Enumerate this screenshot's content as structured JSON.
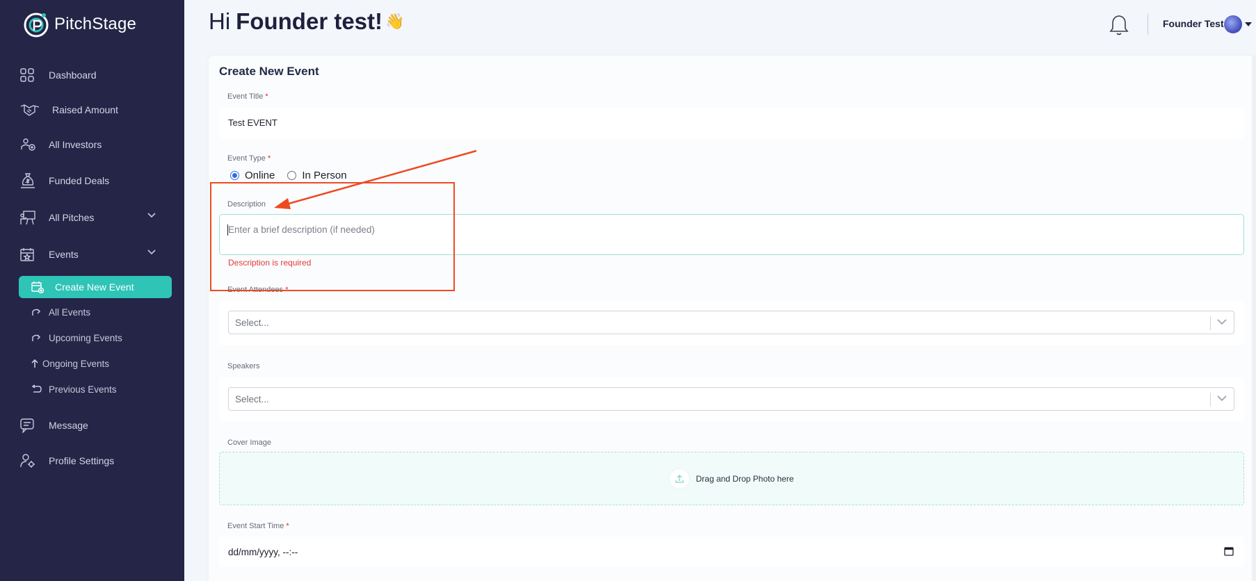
{
  "brand": {
    "logo_text": "PitchStage"
  },
  "sidebar": {
    "items": [
      {
        "label": "Dashboard",
        "icon": "dashboard-icon"
      },
      {
        "label": "Raised Amount",
        "icon": "handshake-icon"
      },
      {
        "label": "All Investors",
        "icon": "investors-icon"
      },
      {
        "label": "Funded Deals",
        "icon": "money-bag-icon"
      },
      {
        "label": "All Pitches",
        "icon": "presentation-icon"
      },
      {
        "label": "Events",
        "icon": "calendar-icon"
      },
      {
        "label": "Message",
        "icon": "message-icon"
      },
      {
        "label": "Profile Settings",
        "icon": "profile-settings-icon"
      }
    ],
    "events_submenu": [
      {
        "label": "Create New Event",
        "active": true
      },
      {
        "label": "All Events"
      },
      {
        "label": "Upcoming Events"
      },
      {
        "label": "Ongoing Events"
      },
      {
        "label": "Previous Events"
      }
    ]
  },
  "header": {
    "greeting_prefix": "Hi",
    "greeting_name": "Founder test!",
    "greeting_emoji": "👋",
    "user_name": "Founder Test"
  },
  "form": {
    "title": "Create New Event",
    "event_title": {
      "label": "Event Title",
      "required": "*",
      "value": "Test EVENT"
    },
    "event_type": {
      "label": "Event Type",
      "required": "*",
      "options": [
        "Online",
        "In Person"
      ],
      "selected": "Online"
    },
    "description": {
      "label": "Description",
      "placeholder": "Enter a brief description (if needed)",
      "error": "Description is required"
    },
    "attendees": {
      "label": "Event Attendees",
      "required": "*",
      "placeholder": "Select..."
    },
    "speakers": {
      "label": "Speakers",
      "placeholder": "Select..."
    },
    "cover_image": {
      "label": "Cover Image",
      "dropzone_text": "Drag and Drop Photo here"
    },
    "start_time": {
      "label": "Event Start Time",
      "required": "*",
      "value": "dd/mm/yyyy, --:--"
    }
  },
  "colors": {
    "sidebar_bg": "#252547",
    "accent": "#2ec4b6",
    "error": "#e33a3a",
    "annotation": "#ee4a22"
  }
}
